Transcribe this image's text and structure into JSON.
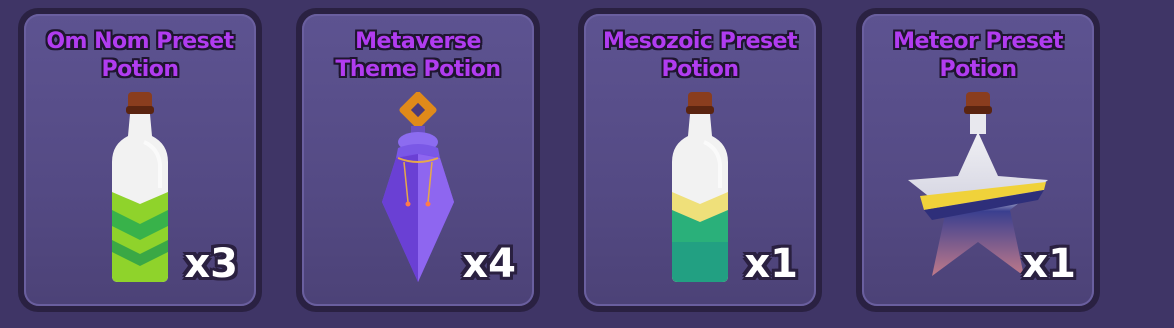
{
  "inventory": {
    "items": [
      {
        "name": "Om Nom Preset Potion",
        "count": "x3",
        "icon": "green-chevron-bottle-icon"
      },
      {
        "name": "Metaverse Theme Potion",
        "count": "x4",
        "icon": "purple-crystal-potion-icon"
      },
      {
        "name": "Mesozoic Preset Potion",
        "count": "x1",
        "icon": "teal-yellow-bottle-icon"
      },
      {
        "name": "Meteor Preset Potion",
        "count": "x1",
        "icon": "star-bottle-icon"
      }
    ]
  },
  "colors": {
    "background": "#3f3566",
    "card_frame": "#2a2142",
    "card_fill": "#5d5391",
    "title_text": "#b13cf0",
    "count_text": "#ffffff"
  }
}
